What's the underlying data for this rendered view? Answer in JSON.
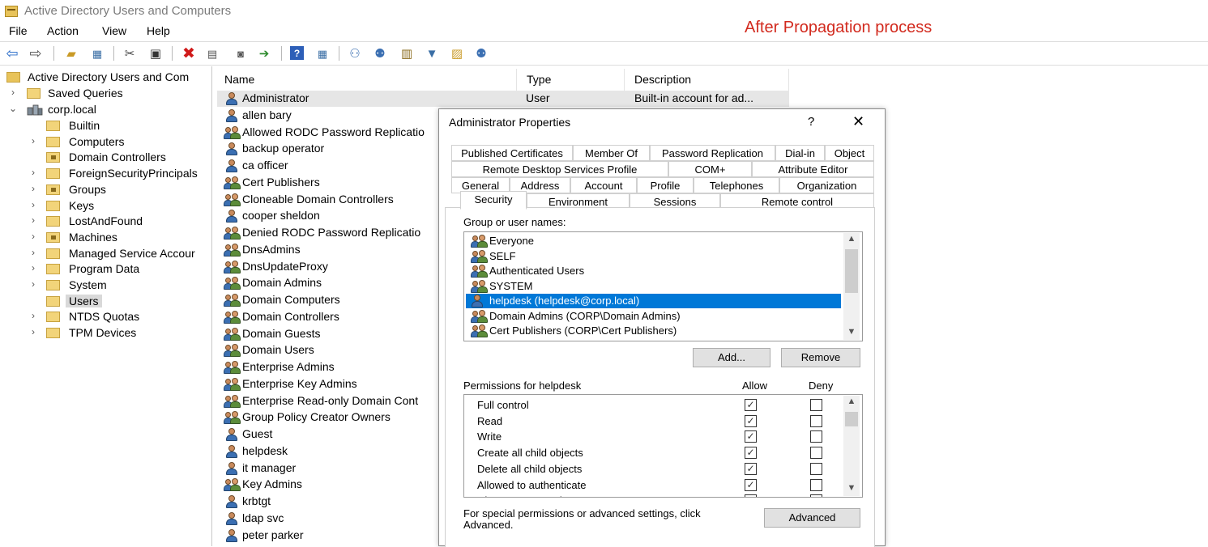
{
  "window": {
    "title": "Active Directory Users and Computers",
    "annotation": "After Propagation process"
  },
  "menu": [
    "File",
    "Action",
    "View",
    "Help"
  ],
  "toolbar_icons": [
    "back-arrow-icon",
    "forward-arrow-icon",
    "up-folder-icon",
    "details-view-icon",
    "cut-icon",
    "clipboard-icon",
    "delete-icon",
    "properties-icon",
    "refresh-icon",
    "export-icon",
    "help-icon",
    "mmc-view-icon",
    "new-user-icon",
    "new-group-icon",
    "new-ou-icon",
    "filter-icon",
    "find-icon",
    "add-to-group-icon"
  ],
  "tree": {
    "root": "Active Directory Users and Com",
    "saved_queries": "Saved Queries",
    "domain": "corp.local",
    "children": [
      {
        "label": "Builtin",
        "expand": false,
        "type": "folder"
      },
      {
        "label": "Computers",
        "expand": true,
        "type": "folder"
      },
      {
        "label": "Domain Controllers",
        "expand": false,
        "type": "ou"
      },
      {
        "label": "ForeignSecurityPrincipals",
        "expand": true,
        "type": "folder"
      },
      {
        "label": "Groups",
        "expand": true,
        "type": "ou"
      },
      {
        "label": "Keys",
        "expand": true,
        "type": "folder"
      },
      {
        "label": "LostAndFound",
        "expand": true,
        "type": "folder"
      },
      {
        "label": "Machines",
        "expand": true,
        "type": "ou"
      },
      {
        "label": "Managed Service Accour",
        "expand": true,
        "type": "folder"
      },
      {
        "label": "Program Data",
        "expand": true,
        "type": "folder"
      },
      {
        "label": "System",
        "expand": true,
        "type": "folder"
      },
      {
        "label": "Users",
        "expand": false,
        "type": "folder",
        "selected": true
      },
      {
        "label": "NTDS Quotas",
        "expand": true,
        "type": "folder"
      },
      {
        "label": "TPM Devices",
        "expand": true,
        "type": "folder"
      }
    ]
  },
  "list": {
    "columns": [
      "Name",
      "Type",
      "Description"
    ],
    "rows": [
      {
        "name": "Administrator",
        "type": "User",
        "desc": "Built-in account for ad...",
        "kind": "user"
      },
      {
        "name": "allen bary",
        "type": "",
        "desc": "",
        "kind": "user"
      },
      {
        "name": "Allowed RODC Password Replicatio",
        "type": "",
        "desc": "",
        "kind": "group"
      },
      {
        "name": "backup operator",
        "type": "",
        "desc": "",
        "kind": "user"
      },
      {
        "name": "ca officer",
        "type": "",
        "desc": "",
        "kind": "user"
      },
      {
        "name": "Cert Publishers",
        "type": "",
        "desc": "",
        "kind": "group"
      },
      {
        "name": "Cloneable Domain Controllers",
        "type": "",
        "desc": "",
        "kind": "group"
      },
      {
        "name": "cooper sheldon",
        "type": "",
        "desc": "",
        "kind": "user"
      },
      {
        "name": "Denied RODC Password Replicatio",
        "type": "",
        "desc": "",
        "kind": "group"
      },
      {
        "name": "DnsAdmins",
        "type": "",
        "desc": "",
        "kind": "group"
      },
      {
        "name": "DnsUpdateProxy",
        "type": "",
        "desc": "",
        "kind": "group"
      },
      {
        "name": "Domain Admins",
        "type": "",
        "desc": "",
        "kind": "group"
      },
      {
        "name": "Domain Computers",
        "type": "",
        "desc": "",
        "kind": "group"
      },
      {
        "name": "Domain Controllers",
        "type": "",
        "desc": "",
        "kind": "group"
      },
      {
        "name": "Domain Guests",
        "type": "",
        "desc": "",
        "kind": "group"
      },
      {
        "name": "Domain Users",
        "type": "",
        "desc": "",
        "kind": "group"
      },
      {
        "name": "Enterprise Admins",
        "type": "",
        "desc": "",
        "kind": "group"
      },
      {
        "name": "Enterprise Key Admins",
        "type": "",
        "desc": "",
        "kind": "group"
      },
      {
        "name": "Enterprise Read-only Domain Cont",
        "type": "",
        "desc": "",
        "kind": "group"
      },
      {
        "name": "Group Policy Creator Owners",
        "type": "",
        "desc": "",
        "kind": "group"
      },
      {
        "name": "Guest",
        "type": "",
        "desc": "",
        "kind": "user"
      },
      {
        "name": "helpdesk",
        "type": "",
        "desc": "",
        "kind": "user"
      },
      {
        "name": "it manager",
        "type": "",
        "desc": "",
        "kind": "user"
      },
      {
        "name": "Key Admins",
        "type": "",
        "desc": "",
        "kind": "group"
      },
      {
        "name": "krbtgt",
        "type": "",
        "desc": "",
        "kind": "user"
      },
      {
        "name": "ldap svc",
        "type": "",
        "desc": "",
        "kind": "user"
      },
      {
        "name": "peter parker",
        "type": "",
        "desc": "",
        "kind": "user"
      }
    ]
  },
  "dialog": {
    "title": "Administrator Properties",
    "help": "?",
    "close": "✕",
    "tabs_row1": [
      "Published Certificates",
      "Member Of",
      "Password Replication",
      "Dial-in",
      "Object"
    ],
    "tabs_row2": [
      "Remote Desktop Services Profile",
      "COM+",
      "Attribute Editor"
    ],
    "tabs_row3": [
      "General",
      "Address",
      "Account",
      "Profile",
      "Telephones",
      "Organization"
    ],
    "tabs_row4": [
      "Security",
      "Environment",
      "Sessions",
      "Remote control"
    ],
    "active_tab": "Security",
    "group_label": "Group or user names:",
    "principals": [
      {
        "name": "Everyone",
        "kind": "group"
      },
      {
        "name": "SELF",
        "kind": "group"
      },
      {
        "name": "Authenticated Users",
        "kind": "group"
      },
      {
        "name": "SYSTEM",
        "kind": "group"
      },
      {
        "name": "helpdesk (helpdesk@corp.local)",
        "kind": "user",
        "selected": true
      },
      {
        "name": "Domain Admins (CORP\\Domain Admins)",
        "kind": "group"
      },
      {
        "name": "Cert Publishers (CORP\\Cert Publishers)",
        "kind": "group"
      }
    ],
    "add_button": "Add...",
    "remove_button": "Remove",
    "permissions_label": "Permissions for helpdesk",
    "allow_header": "Allow",
    "deny_header": "Deny",
    "permissions": [
      {
        "name": "Full control",
        "allow": true,
        "deny": false
      },
      {
        "name": "Read",
        "allow": true,
        "deny": false
      },
      {
        "name": "Write",
        "allow": true,
        "deny": false
      },
      {
        "name": "Create all child objects",
        "allow": true,
        "deny": false
      },
      {
        "name": "Delete all child objects",
        "allow": true,
        "deny": false
      },
      {
        "name": "Allowed to authenticate",
        "allow": true,
        "deny": false
      },
      {
        "name": "Change password",
        "allow": true,
        "deny": false
      }
    ],
    "special_text_1": "For special permissions or advanced settings, click",
    "special_text_2": "Advanced.",
    "advanced_button": "Advanced"
  }
}
